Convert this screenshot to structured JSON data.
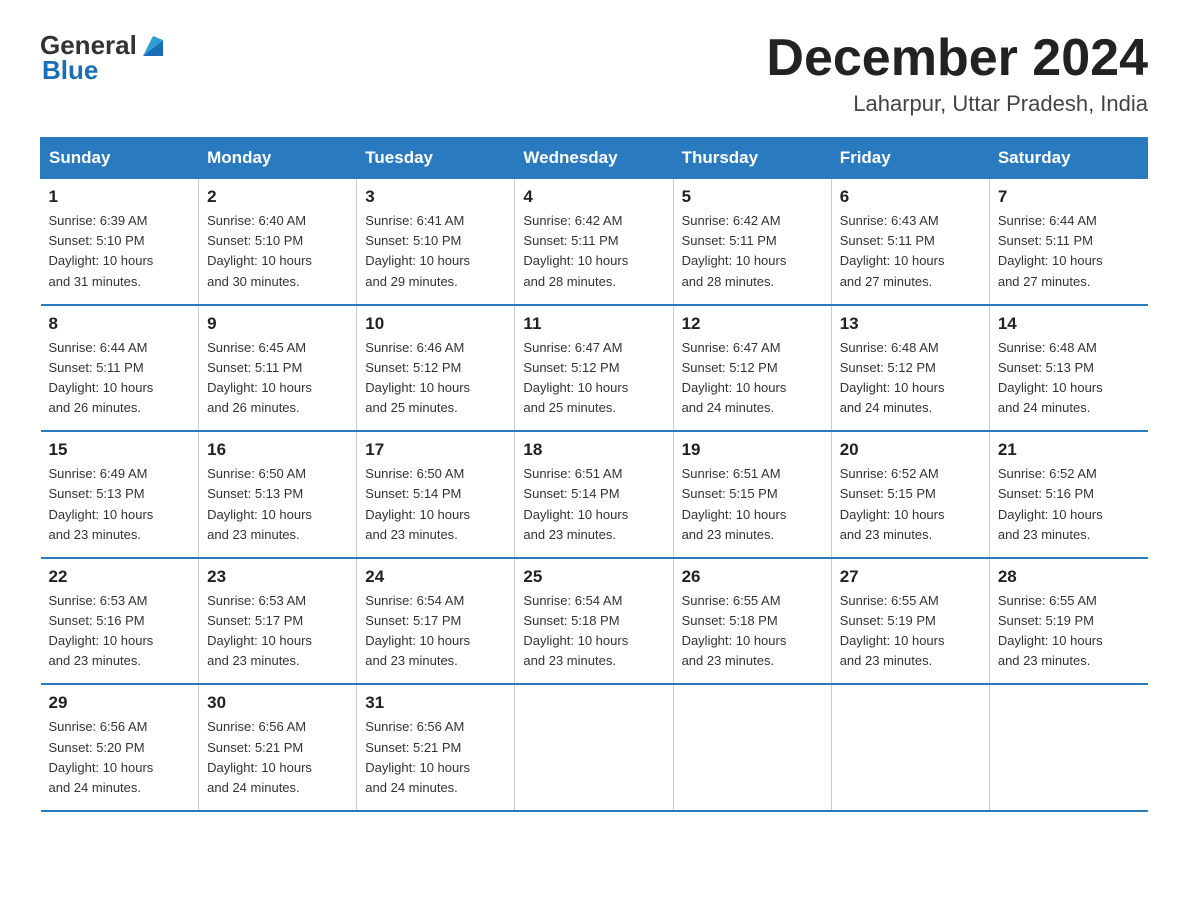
{
  "logo": {
    "text_general": "General",
    "text_blue": "Blue",
    "tagline": "GeneralBlue"
  },
  "title": "December 2024",
  "subtitle": "Laharpur, Uttar Pradesh, India",
  "days_of_week": [
    "Sunday",
    "Monday",
    "Tuesday",
    "Wednesday",
    "Thursday",
    "Friday",
    "Saturday"
  ],
  "weeks": [
    [
      {
        "day": "1",
        "sunrise": "6:39 AM",
        "sunset": "5:10 PM",
        "daylight": "10 hours and 31 minutes."
      },
      {
        "day": "2",
        "sunrise": "6:40 AM",
        "sunset": "5:10 PM",
        "daylight": "10 hours and 30 minutes."
      },
      {
        "day": "3",
        "sunrise": "6:41 AM",
        "sunset": "5:10 PM",
        "daylight": "10 hours and 29 minutes."
      },
      {
        "day": "4",
        "sunrise": "6:42 AM",
        "sunset": "5:11 PM",
        "daylight": "10 hours and 28 minutes."
      },
      {
        "day": "5",
        "sunrise": "6:42 AM",
        "sunset": "5:11 PM",
        "daylight": "10 hours and 28 minutes."
      },
      {
        "day": "6",
        "sunrise": "6:43 AM",
        "sunset": "5:11 PM",
        "daylight": "10 hours and 27 minutes."
      },
      {
        "day": "7",
        "sunrise": "6:44 AM",
        "sunset": "5:11 PM",
        "daylight": "10 hours and 27 minutes."
      }
    ],
    [
      {
        "day": "8",
        "sunrise": "6:44 AM",
        "sunset": "5:11 PM",
        "daylight": "10 hours and 26 minutes."
      },
      {
        "day": "9",
        "sunrise": "6:45 AM",
        "sunset": "5:11 PM",
        "daylight": "10 hours and 26 minutes."
      },
      {
        "day": "10",
        "sunrise": "6:46 AM",
        "sunset": "5:12 PM",
        "daylight": "10 hours and 25 minutes."
      },
      {
        "day": "11",
        "sunrise": "6:47 AM",
        "sunset": "5:12 PM",
        "daylight": "10 hours and 25 minutes."
      },
      {
        "day": "12",
        "sunrise": "6:47 AM",
        "sunset": "5:12 PM",
        "daylight": "10 hours and 24 minutes."
      },
      {
        "day": "13",
        "sunrise": "6:48 AM",
        "sunset": "5:12 PM",
        "daylight": "10 hours and 24 minutes."
      },
      {
        "day": "14",
        "sunrise": "6:48 AM",
        "sunset": "5:13 PM",
        "daylight": "10 hours and 24 minutes."
      }
    ],
    [
      {
        "day": "15",
        "sunrise": "6:49 AM",
        "sunset": "5:13 PM",
        "daylight": "10 hours and 23 minutes."
      },
      {
        "day": "16",
        "sunrise": "6:50 AM",
        "sunset": "5:13 PM",
        "daylight": "10 hours and 23 minutes."
      },
      {
        "day": "17",
        "sunrise": "6:50 AM",
        "sunset": "5:14 PM",
        "daylight": "10 hours and 23 minutes."
      },
      {
        "day": "18",
        "sunrise": "6:51 AM",
        "sunset": "5:14 PM",
        "daylight": "10 hours and 23 minutes."
      },
      {
        "day": "19",
        "sunrise": "6:51 AM",
        "sunset": "5:15 PM",
        "daylight": "10 hours and 23 minutes."
      },
      {
        "day": "20",
        "sunrise": "6:52 AM",
        "sunset": "5:15 PM",
        "daylight": "10 hours and 23 minutes."
      },
      {
        "day": "21",
        "sunrise": "6:52 AM",
        "sunset": "5:16 PM",
        "daylight": "10 hours and 23 minutes."
      }
    ],
    [
      {
        "day": "22",
        "sunrise": "6:53 AM",
        "sunset": "5:16 PM",
        "daylight": "10 hours and 23 minutes."
      },
      {
        "day": "23",
        "sunrise": "6:53 AM",
        "sunset": "5:17 PM",
        "daylight": "10 hours and 23 minutes."
      },
      {
        "day": "24",
        "sunrise": "6:54 AM",
        "sunset": "5:17 PM",
        "daylight": "10 hours and 23 minutes."
      },
      {
        "day": "25",
        "sunrise": "6:54 AM",
        "sunset": "5:18 PM",
        "daylight": "10 hours and 23 minutes."
      },
      {
        "day": "26",
        "sunrise": "6:55 AM",
        "sunset": "5:18 PM",
        "daylight": "10 hours and 23 minutes."
      },
      {
        "day": "27",
        "sunrise": "6:55 AM",
        "sunset": "5:19 PM",
        "daylight": "10 hours and 23 minutes."
      },
      {
        "day": "28",
        "sunrise": "6:55 AM",
        "sunset": "5:19 PM",
        "daylight": "10 hours and 23 minutes."
      }
    ],
    [
      {
        "day": "29",
        "sunrise": "6:56 AM",
        "sunset": "5:20 PM",
        "daylight": "10 hours and 24 minutes."
      },
      {
        "day": "30",
        "sunrise": "6:56 AM",
        "sunset": "5:21 PM",
        "daylight": "10 hours and 24 minutes."
      },
      {
        "day": "31",
        "sunrise": "6:56 AM",
        "sunset": "5:21 PM",
        "daylight": "10 hours and 24 minutes."
      },
      null,
      null,
      null,
      null
    ]
  ],
  "labels": {
    "sunrise": "Sunrise:",
    "sunset": "Sunset:",
    "daylight": "Daylight:"
  }
}
